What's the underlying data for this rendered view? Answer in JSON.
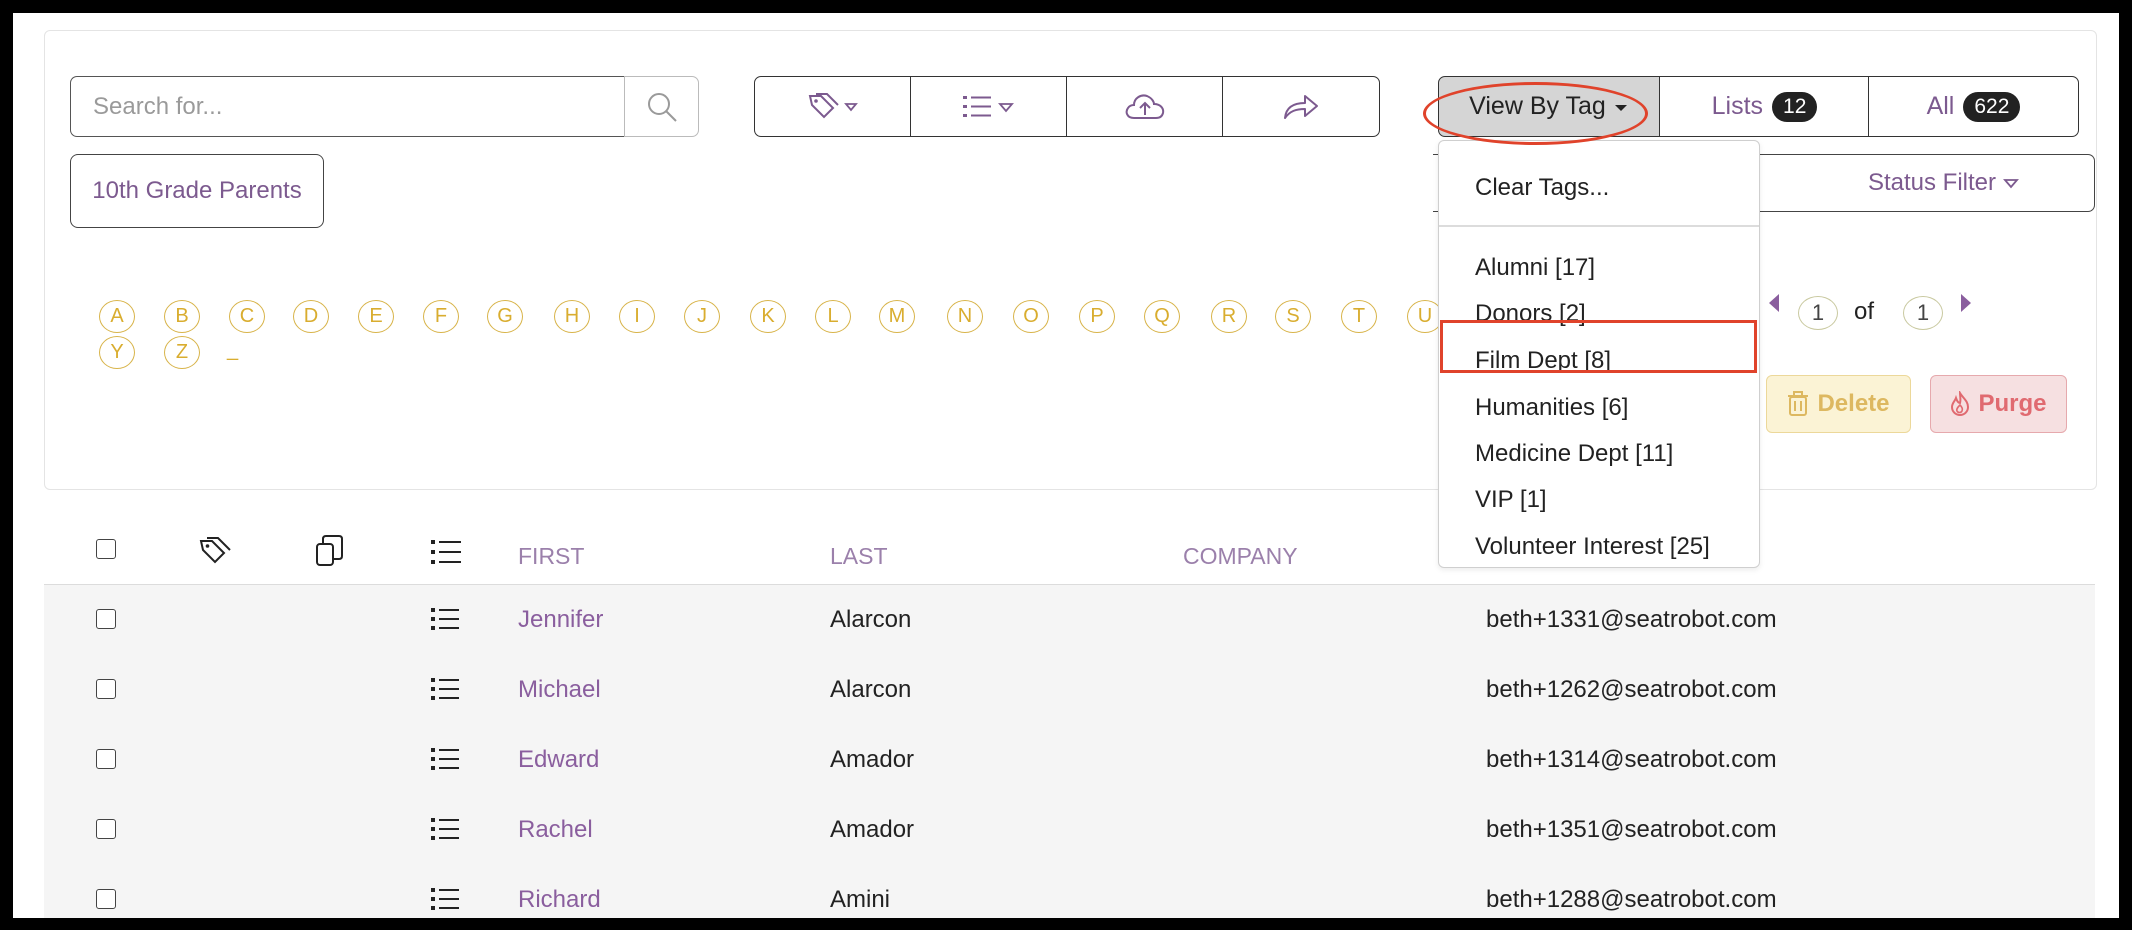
{
  "search": {
    "placeholder": "Search for..."
  },
  "toolbar": {
    "tag_icon": "tag-icon",
    "list_icon": "list-icon",
    "upload_icon": "cloud-upload-icon",
    "share_icon": "share-arrow-icon"
  },
  "view_by_tag": {
    "label": "View By Tag",
    "lists_label": "Lists",
    "lists_count": "12",
    "all_label": "All",
    "all_count": "622"
  },
  "tag_chip": "10th Grade Parents",
  "status_filter": "Status Filter",
  "letters": [
    "A",
    "B",
    "C",
    "D",
    "E",
    "F",
    "G",
    "H",
    "I",
    "J",
    "K",
    "L",
    "M",
    "N",
    "O",
    "P",
    "Q",
    "R",
    "S",
    "T",
    "U",
    "Y",
    "Z"
  ],
  "letter_underscore": "_",
  "pagination": {
    "current": "1",
    "of": "of",
    "total": "1"
  },
  "actions": {
    "delete": "Delete",
    "purge": "Purge"
  },
  "table": {
    "headers": {
      "first": "FIRST",
      "last": "LAST",
      "company": "COMPANY"
    },
    "rows": [
      {
        "first": "Jennifer",
        "last": "Alarcon",
        "email": "beth+1331@seatrobot.com"
      },
      {
        "first": "Michael",
        "last": "Alarcon",
        "email": "beth+1262@seatrobot.com"
      },
      {
        "first": "Edward",
        "last": "Amador",
        "email": "beth+1314@seatrobot.com"
      },
      {
        "first": "Rachel",
        "last": "Amador",
        "email": "beth+1351@seatrobot.com"
      },
      {
        "first": "Richard",
        "last": "Amini",
        "email": "beth+1288@seatrobot.com"
      }
    ]
  },
  "dropdown": {
    "clear": "Clear Tags...",
    "items": [
      "Alumni [17]",
      "Donors [2]",
      "Film Dept [8]",
      "Humanities [6]",
      "Medicine Dept [11]",
      "VIP [1]",
      "Volunteer Interest [25]"
    ]
  },
  "colors": {
    "accent_purple": "#7c5a8f",
    "letter_gold": "#d9ad2f",
    "highlight_red": "#e0432b"
  }
}
